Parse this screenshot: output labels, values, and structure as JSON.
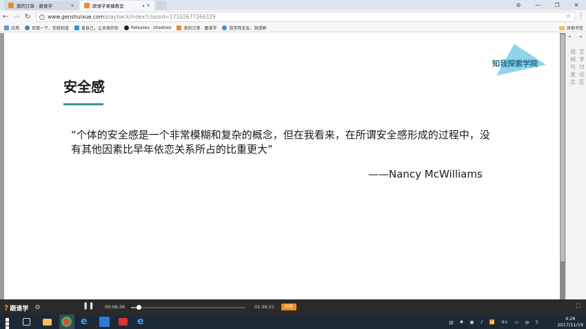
{
  "browser": {
    "tabs": [
      {
        "label": "我的订单 - 跟谁学",
        "close": "×"
      },
      {
        "label": "跟谁学录播教室",
        "sound": "◂",
        "close": "×"
      }
    ],
    "window_buttons": [
      "⊖",
      "—",
      "❐",
      "✕"
    ],
    "address": {
      "host": "www.genshuixue.com",
      "path": "/playback/index?classid=17102677266329"
    },
    "bookmarks": [
      {
        "label": "应用",
        "color": "#6b8fd6"
      },
      {
        "label": "百度一下，你就知道",
        "color": "#4a7bd0"
      },
      {
        "label": "爱自己，让未来的你",
        "color": "#3d8fd9"
      },
      {
        "label": "Releases · shadows",
        "color": "#222222"
      },
      {
        "label": "我的订单 - 跟谁学",
        "color": "#f08c1e"
      },
      {
        "label": "我学而无友，则孤陋",
        "color": "#3d8fd9"
      }
    ],
    "other_bookmarks": "其他书签"
  },
  "slide": {
    "logo_text": "知我探索学院",
    "title": "安全感",
    "quote": "“个体的安全感是一个非常模糊和复杂的概念，但在我看来，在所谓安全感形成的过程中，没有其他因素比早年依恋关系所占的比重更大”",
    "attribution": "——Nancy McWilliams",
    "accent_color": "#3d8fa6"
  },
  "side_panel": {
    "col_a": "视频与发言",
    "col_b": "文字讨论区"
  },
  "player": {
    "brand": "跟谁学",
    "current_time": "00:06:36",
    "total_time": "01:36:21",
    "progress_fraction": 0.069,
    "quality_label": "标清",
    "accent_color": "#f08c1e"
  },
  "taskbar": {
    "tray_items": [
      "拼",
      "✱",
      "▣",
      "♪",
      "📶",
      "ᐊ×",
      "▭",
      "中",
      "S"
    ],
    "time": "4:26",
    "date": "2017/11/19"
  }
}
